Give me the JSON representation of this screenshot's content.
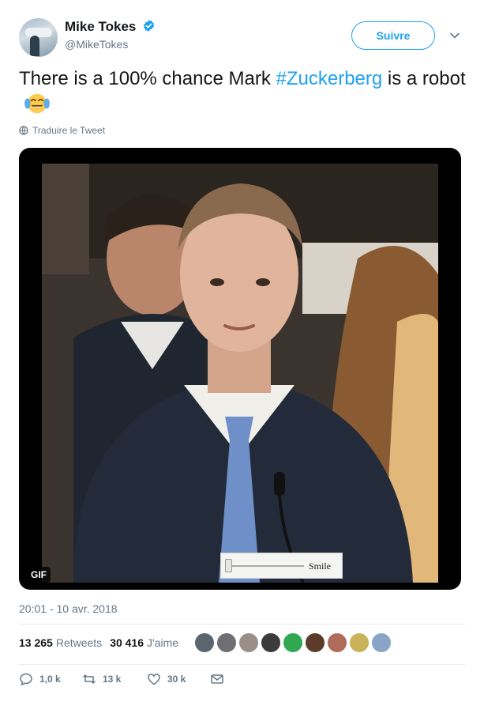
{
  "user": {
    "display_name": "Mike Tokes",
    "handle": "@MikeTokes",
    "verified": true,
    "follow_label": "Suivre"
  },
  "tweet": {
    "text_part1": "There is a 100% chance Mark ",
    "hashtag": "#Zuckerberg",
    "text_part2": " is a robot",
    "emoji": "face-with-tears-of-joy",
    "translate_label": "Traduire le Tweet"
  },
  "media": {
    "gif_badge": "GIF",
    "slider_label": "Smile"
  },
  "timestamp": "20:01 - 10 avr. 2018",
  "stats": {
    "retweets_count": "13 265",
    "retweets_label": "Retweets",
    "likes_count": "30 416",
    "likes_label": "J'aime"
  },
  "liker_colors": [
    "#5a6570",
    "#6d6f72",
    "#9a8f88",
    "#3b3b3b",
    "#2fa84f",
    "#5c3b2a",
    "#b06b5a",
    "#c9b25a",
    "#8aa4c8"
  ],
  "actions": {
    "reply_count": "1,0 k",
    "retweet_count": "13 k",
    "like_count": "30 k"
  },
  "colors": {
    "accent": "#1da1f2",
    "secondary_text": "#657786"
  }
}
